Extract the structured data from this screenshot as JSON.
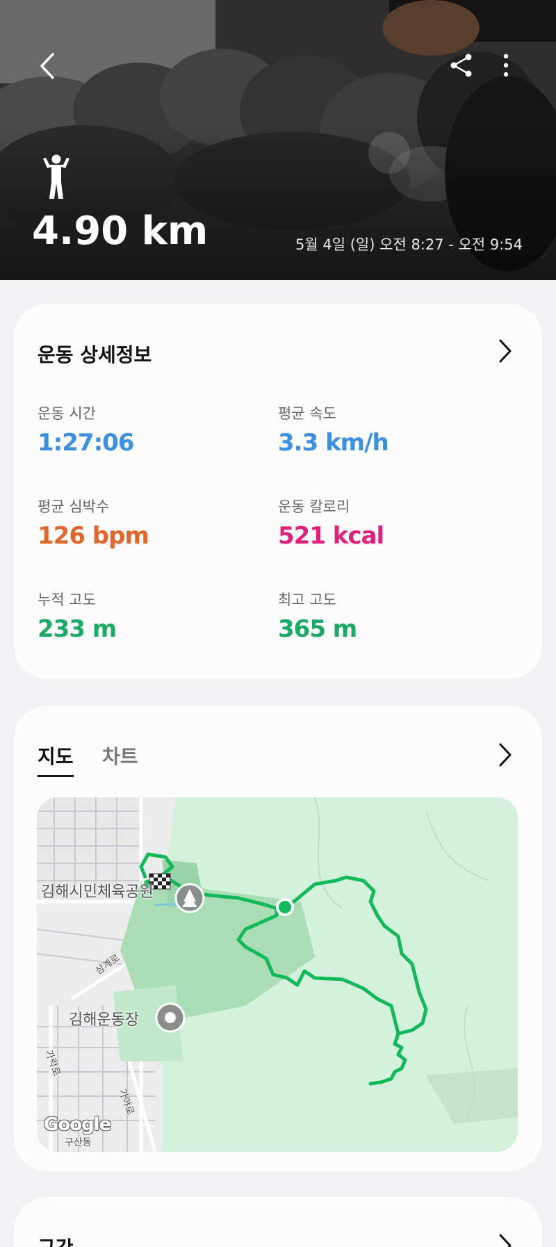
{
  "hero": {
    "distance": "4.90 km",
    "datetime": "5월 4일 (일) 오전 8:27 - 오전 9:54",
    "activity_icon": "standing-person-icon"
  },
  "details": {
    "title": "운동 상세정보",
    "metrics": [
      {
        "label": "운동 시간",
        "value": "1:27:06",
        "color": "#3d8fe0"
      },
      {
        "label": "평균 속도",
        "value": "3.3 km/h",
        "color": "#3d8fe0"
      },
      {
        "label": "평균 심박수",
        "value": "126 bpm",
        "color": "#e0672b"
      },
      {
        "label": "운동 칼로리",
        "value": "521 kcal",
        "color": "#e0217c"
      },
      {
        "label": "누적 고도",
        "value": "233 m",
        "color": "#1aaa63"
      },
      {
        "label": "최고 고도",
        "value": "365 m",
        "color": "#1aaa63"
      }
    ]
  },
  "map_card": {
    "tabs": [
      {
        "label": "지도",
        "active": true
      },
      {
        "label": "차트",
        "active": false
      }
    ],
    "map": {
      "pois": [
        "김해시민체육공원",
        "김해운동장"
      ],
      "roads": [
        "삼계로",
        "가락로",
        "가야로",
        "구산동"
      ],
      "attribution": "Google",
      "route_color": "#12b85a"
    }
  },
  "sections": {
    "title": "구간"
  }
}
